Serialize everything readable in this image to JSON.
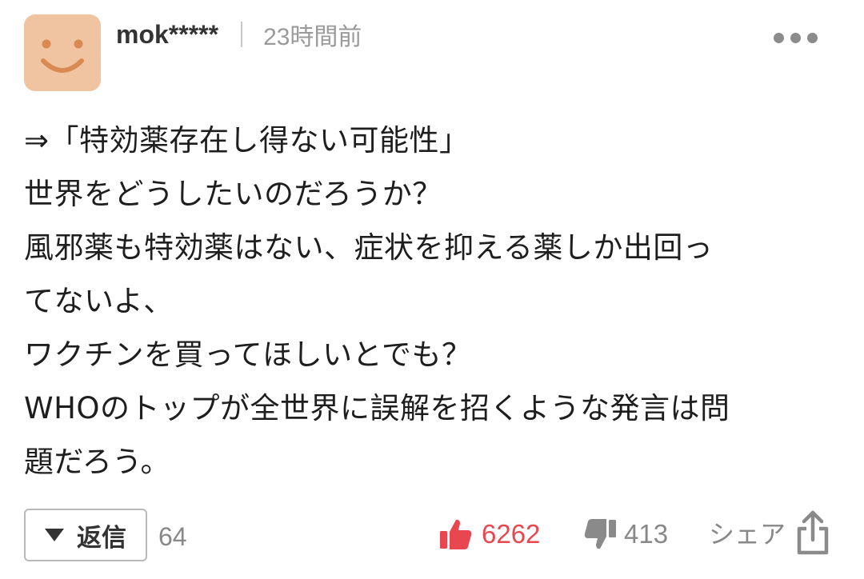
{
  "comment": {
    "user": {
      "name": "mok*****",
      "avatar": "smiley-face-avatar"
    },
    "timestamp": "23時間前",
    "more_icon": "more-dots-icon",
    "body_lines": [
      "⇒「特効薬存在し得ない可能性」",
      "世界をどうしたいのだろうか？",
      "風邪薬も特効薬はない、症状を抑える薬しか出回っ",
      "てないよ、",
      "ワクチンを買ってほしいとでも？",
      "WHOのトップが全世界に誤解を招くような発言は問",
      "題だろう。"
    ]
  },
  "actions": {
    "reply": {
      "label": "返信",
      "count": "64",
      "icon": "triangle-down-icon"
    },
    "like": {
      "count": "6262",
      "icon": "thumbs-up-icon",
      "color": "#e8474f"
    },
    "dislike": {
      "count": "413",
      "icon": "thumbs-down-icon",
      "color": "#8a8a8a"
    },
    "share": {
      "label": "シェア",
      "icon": "share-icon",
      "color": "#8a8a8a"
    }
  },
  "colors": {
    "avatar_bg": "#f0c4a0",
    "avatar_face": "#d98a52",
    "text": "#1e1e1e",
    "muted": "#9a9a9a"
  }
}
